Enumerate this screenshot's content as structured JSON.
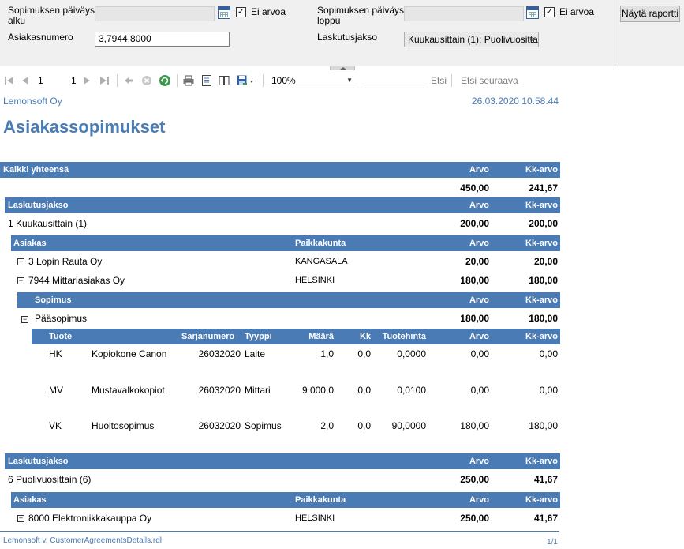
{
  "params": {
    "start_label_1": "Sopimuksen päiväys",
    "start_label_2": "alku",
    "end_label_1": "Sopimuksen päiväys",
    "end_label_2": "loppu",
    "no_value_label": "Ei arvoa",
    "no_value_check": "✓",
    "customer_label": "Asiakasnumero",
    "customer_value": "3,7944,8000",
    "billing_label": "Laskutusjakso",
    "billing_value": "Kuukausittain (1); Puolivuosittai",
    "view_report": "Näytä raportti"
  },
  "toolbar": {
    "page_current": "1",
    "page_total": "1",
    "zoom": "100%",
    "find": "Etsi",
    "find_next": "Etsi seuraava"
  },
  "report": {
    "company": "Lemonsoft Oy",
    "timestamp": "26.03.2020 10.58.44",
    "title": "Asiakassopimukset",
    "total_label": "Kaikki yhteensä",
    "col_arvo": "Arvo",
    "col_kkarvo": "Kk-arvo",
    "total_arvo": "450,00",
    "total_kkarvo": "241,67",
    "billing_header": "Laskutusjakso",
    "customer_header": "Asiakas",
    "city_header": "Paikkakunta",
    "agreement_header": "Sopimus",
    "product_headers": {
      "tuote": "Tuote",
      "sarjanumero": "Sarjanumero",
      "tyyppi": "Tyyppi",
      "maara": "Määrä",
      "kk": "Kk",
      "tuotehinta": "Tuotehinta"
    },
    "group1": {
      "name": "1 Kuukausittain (1)",
      "arvo": "200,00",
      "kkarvo": "200,00",
      "customers": [
        {
          "name": "3 Lopin Rauta Oy",
          "city": "KANGASALA",
          "arvo": "20,00",
          "kkarvo": "20,00",
          "toggle": "+"
        },
        {
          "name": "7944 Mittariasiakas Oy",
          "city": "HELSINKI",
          "arvo": "180,00",
          "kkarvo": "180,00",
          "toggle": "−"
        }
      ],
      "agreement": {
        "name": "Pääsopimus",
        "arvo": "180,00",
        "kkarvo": "180,00",
        "toggle": "−"
      },
      "products": [
        {
          "code": "HK",
          "name": "Kopiokone Canon",
          "serial": "26032020",
          "type": "Laite",
          "qty": "1,0",
          "kk": "0,0",
          "price": "0,0000",
          "arvo": "0,00",
          "kkarvo": "0,00"
        },
        {
          "code": "MV",
          "name": "Mustavalkokopiot",
          "serial": "26032020",
          "type": "Mittari",
          "qty": "9 000,0",
          "kk": "0,0",
          "price": "0,0100",
          "arvo": "0,00",
          "kkarvo": "0,00"
        },
        {
          "code": "VK",
          "name": "Huoltosopimus",
          "serial": "26032020",
          "type": "Sopimus",
          "qty": "2,0",
          "kk": "0,0",
          "price": "90,0000",
          "arvo": "180,00",
          "kkarvo": "180,00"
        }
      ]
    },
    "group2": {
      "name": "6 Puolivuosittain (6)",
      "arvo": "250,00",
      "kkarvo": "41,67",
      "customers": [
        {
          "name": "8000 Elektroniikkakauppa Oy",
          "city": "HELSINKI",
          "arvo": "250,00",
          "kkarvo": "41,67",
          "toggle": "+"
        }
      ]
    },
    "footer_left": "Lemonsoft v, CustomerAgreementsDetails.rdl",
    "footer_right": "1/1"
  },
  "icons": {
    "first_page": "first-page-icon",
    "prev_page": "previous-page-icon",
    "next_page": "next-page-icon",
    "last_page": "last-page-icon",
    "back": "back-icon",
    "stop": "stop-icon",
    "refresh": "refresh-icon",
    "print": "print-icon",
    "print_layout": "print-layout-icon",
    "page_setup": "page-setup-icon",
    "export": "export-icon"
  },
  "colors": {
    "band": "#4b7bb4",
    "accent_text": "#4a7cb5"
  }
}
